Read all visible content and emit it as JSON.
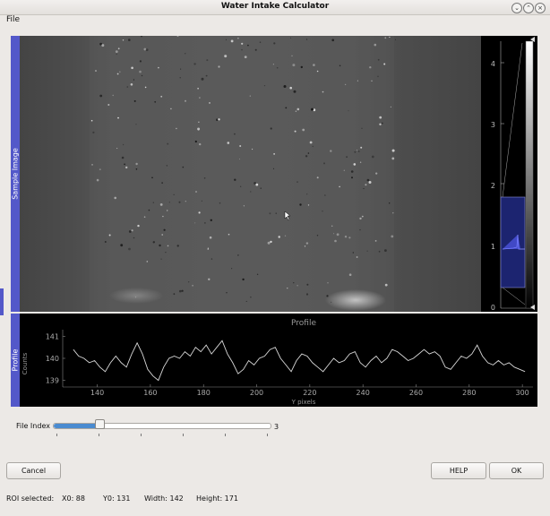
{
  "window": {
    "title": "Water Intake Calculator"
  },
  "menu": {
    "file": "File"
  },
  "sample": {
    "label": "Sample Image"
  },
  "histogram": {
    "ticks": [
      "0",
      "1",
      "2",
      "3",
      "4"
    ]
  },
  "profile": {
    "label": "Profile",
    "ylabel": "Counts",
    "xlabel": "Y pixels",
    "title": "Profile",
    "chart_data": {
      "type": "line",
      "title": "Profile",
      "xlabel": "Y pixels",
      "ylabel": "Counts",
      "xlim": [
        127,
        304
      ],
      "ylim": [
        138.7,
        141.3
      ],
      "xticks": [
        140,
        160,
        180,
        200,
        220,
        240,
        260,
        280,
        300
      ],
      "yticks": [
        139,
        140,
        141
      ],
      "x": [
        131,
        133,
        135,
        137,
        139,
        141,
        143,
        145,
        147,
        149,
        151,
        153,
        155,
        157,
        159,
        161,
        163,
        165,
        167,
        169,
        171,
        173,
        175,
        177,
        179,
        181,
        183,
        185,
        187,
        189,
        191,
        193,
        195,
        197,
        199,
        201,
        203,
        205,
        207,
        209,
        211,
        213,
        215,
        217,
        219,
        221,
        223,
        225,
        227,
        229,
        231,
        233,
        235,
        237,
        239,
        241,
        243,
        245,
        247,
        249,
        251,
        253,
        255,
        257,
        259,
        261,
        263,
        265,
        267,
        269,
        271,
        273,
        275,
        277,
        279,
        281,
        283,
        285,
        287,
        289,
        291,
        293,
        295,
        297,
        299,
        301
      ],
      "values": [
        140.4,
        140.1,
        140.0,
        139.8,
        139.9,
        139.6,
        139.4,
        139.8,
        140.1,
        139.8,
        139.6,
        140.2,
        140.7,
        140.2,
        139.5,
        139.2,
        139.0,
        139.6,
        140.0,
        140.1,
        140.0,
        140.3,
        140.1,
        140.5,
        140.3,
        140.6,
        140.2,
        140.5,
        140.8,
        140.2,
        139.8,
        139.3,
        139.5,
        139.9,
        139.7,
        140.0,
        140.1,
        140.4,
        140.5,
        140.0,
        139.7,
        139.4,
        139.9,
        140.2,
        140.1,
        139.8,
        139.6,
        139.4,
        139.7,
        140.0,
        139.8,
        139.9,
        140.2,
        140.3,
        139.8,
        139.6,
        139.9,
        140.1,
        139.8,
        140.0,
        140.4,
        140.3,
        140.1,
        139.9,
        140.0,
        140.2,
        140.4,
        140.2,
        140.3,
        140.1,
        139.6,
        139.5,
        139.8,
        140.1,
        140.0,
        140.2,
        140.6,
        140.1,
        139.8,
        139.7,
        139.9,
        139.7,
        139.8,
        139.6,
        139.5,
        139.4
      ]
    }
  },
  "slider": {
    "label": "File Index",
    "value": "3",
    "fraction": 0.21
  },
  "buttons": {
    "cancel": "Cancel",
    "help": "HELP",
    "ok": "OK"
  },
  "status": {
    "roi": "ROI selected:",
    "x0": "X0:  88",
    "y0": "Y0:  131",
    "width": "Width:  142",
    "height": "Height:  171"
  }
}
